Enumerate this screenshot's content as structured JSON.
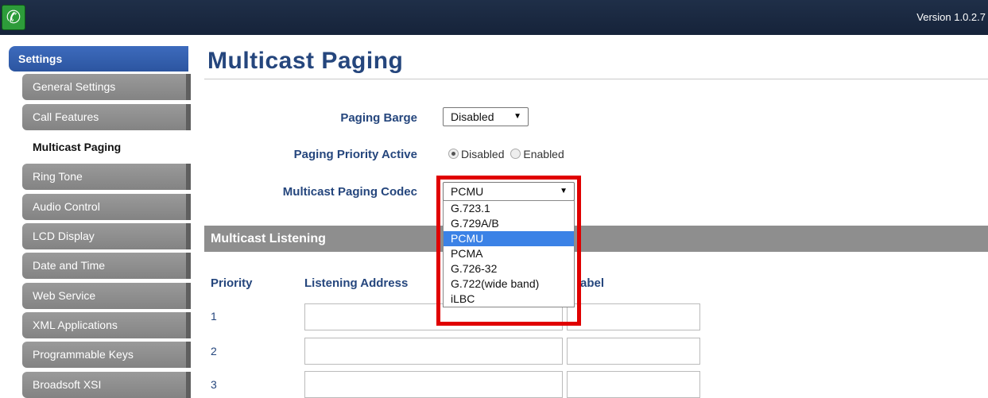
{
  "topbar": {
    "version": "Version 1.0.2.7",
    "logo_icon": "phone-icon"
  },
  "sidebar": {
    "header": "Settings",
    "items": [
      {
        "label": "General Settings"
      },
      {
        "label": "Call Features"
      },
      {
        "label": "Multicast Paging"
      },
      {
        "label": "Ring Tone"
      },
      {
        "label": "Audio Control"
      },
      {
        "label": "LCD Display"
      },
      {
        "label": "Date and Time"
      },
      {
        "label": "Web Service"
      },
      {
        "label": "XML Applications"
      },
      {
        "label": "Programmable Keys"
      },
      {
        "label": "Broadsoft XSI"
      }
    ],
    "active_index": 2
  },
  "main": {
    "title": "Multicast Paging",
    "paging_barge": {
      "label": "Paging Barge",
      "value": "Disabled"
    },
    "paging_priority": {
      "label": "Paging Priority Active",
      "options": [
        "Disabled",
        "Enabled"
      ],
      "selected": "Disabled"
    },
    "codec": {
      "label": "Multicast Paging Codec",
      "value": "PCMU",
      "options": [
        "G.723.1",
        "G.729A/B",
        "PCMU",
        "PCMA",
        "G.726-32",
        "G.722(wide band)",
        "iLBC"
      ]
    },
    "listening": {
      "section_title": "Multicast Listening",
      "columns": [
        "Priority",
        "Listening Address",
        "Label"
      ],
      "label_column_visible": "abel",
      "rows": [
        "1",
        "2",
        "3"
      ]
    }
  },
  "colors": {
    "accent": "#25467d",
    "highlight": "#e00000",
    "selection": "#3b82e6"
  }
}
